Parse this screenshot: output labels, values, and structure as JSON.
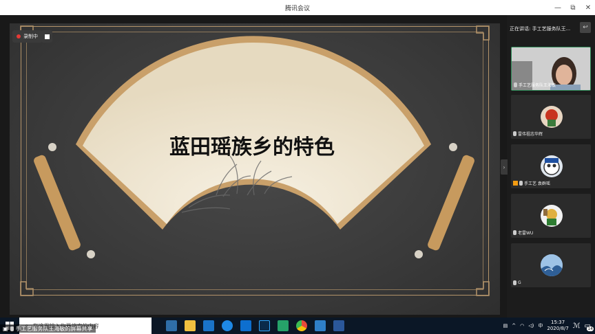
{
  "window": {
    "title": "腾讯会议",
    "minimize": "—",
    "restore": "⧉",
    "close": "✕"
  },
  "share": {
    "recording_label": "录制中",
    "slide_title": "蓝田瑶族乡的特色",
    "caption": "手工艺服务队王海敏的屏幕共享"
  },
  "panel": {
    "speaking_label": "正在讲话: 手工艺服务队王...",
    "participants": [
      {
        "name": "手工艺服务队王海敏",
        "active": true
      },
      {
        "name": "雷伟祖志华辉",
        "active": false
      },
      {
        "name": "手工艺 袁群瑶",
        "active": false
      },
      {
        "name": "老雷WU",
        "active": false
      },
      {
        "name": "G",
        "active": false
      }
    ]
  },
  "taskbar": {
    "search_placeholder": "在这里输入你要搜索的内容",
    "time": "15:37",
    "date": "2020/8/7",
    "notification_count": "14",
    "apps": [
      "store-icon",
      "file-explorer-icon",
      "mail-icon",
      "edge-icon",
      "outlook-icon",
      "photoshop-icon",
      "wps-icon",
      "chrome-icon",
      "photos-icon",
      "word-icon"
    ],
    "app_colors": {
      "store": "#2f6ea8",
      "explorer": "#f0c040",
      "mail": "#1a73c8",
      "edge": "#1e88e5",
      "outlook": "#0d6fcf",
      "photoshop": "#0a2a4a",
      "wps": "#26a269",
      "chrome": "#e84a3a",
      "photos": "#2f7fc8",
      "word": "#2b579a"
    }
  },
  "colors": {
    "frame": "#b4946a",
    "fan_paper": "#efe6d2",
    "fan_border": "#c9a06a",
    "active_tile": "#2e8b57",
    "record": "#e53935"
  }
}
